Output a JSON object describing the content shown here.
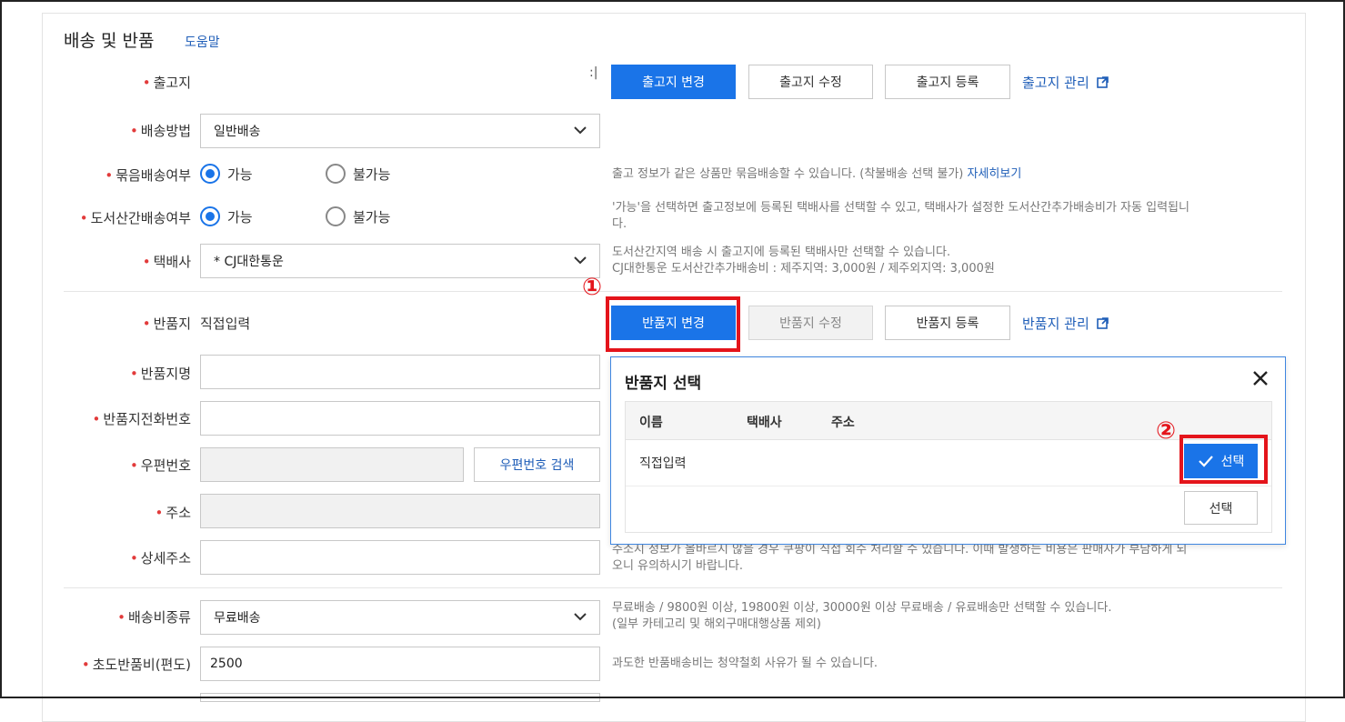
{
  "section": {
    "title": "배송 및 반품",
    "help": "도움말"
  },
  "shipping_from": {
    "label": "출고지",
    "value": ":|",
    "buttons": {
      "change": "출고지 변경",
      "edit": "출고지 수정",
      "register": "출고지 등록"
    },
    "manage_link": "출고지 관리"
  },
  "delivery_method": {
    "label": "배송방법",
    "value": "일반배송"
  },
  "bundle": {
    "label": "묶음배송여부",
    "opt_yes": "가능",
    "opt_no": "불가능",
    "note": "출고 정보가 같은 상품만 묶음배송할 수 있습니다. (착불배송 선택 불가)",
    "note_link": "자세히보기"
  },
  "island": {
    "label": "도서산간배송여부",
    "opt_yes": "가능",
    "opt_no": "불가능",
    "note_line1": "'가능'을 선택하면 출고정보에 등록된 택배사를 선택할 수 있고, 택배사가 설정한 도서산간추가배송비가 자동 입력됩니",
    "note_line2": "다."
  },
  "courier": {
    "label": "택배사",
    "value": "* CJ대한통운",
    "note_line1": "도서산간지역 배송 시 출고지에 등록된 택배사만 선택할 수 있습니다.",
    "note_line2": "CJ대한통운 도서산간추가배송비 : 제주지역: 3,000원 / 제주외지역: 3,000원"
  },
  "return_place": {
    "label": "반품지",
    "value": "직접입력",
    "buttons": {
      "change": "반품지 변경",
      "edit": "반품지 수정",
      "register": "반품지 등록"
    },
    "manage_link": "반품지 관리"
  },
  "return_name": {
    "label": "반품지명"
  },
  "return_phone": {
    "label": "반품지전화번호"
  },
  "zipcode": {
    "label": "우편번호",
    "search_button": "우편번호 검색"
  },
  "address": {
    "label": "주소"
  },
  "address_detail": {
    "label": "상세주소",
    "note_line1": "주소지 정보가 올바르지 않을 경우 쿠팡이 직접 회수 처리할 수 있습니다. 이때 발생하는 비용은 판매자가 부담하게 되",
    "note_line2": "오니 유의하시기 바랍니다."
  },
  "shipping_fee_type": {
    "label": "배송비종류",
    "value": "무료배송",
    "note_line1": "무료배송 / 9800원 이상, 19800원 이상, 30000원 이상 무료배송 / 유료배송만 선택할 수 있습니다.",
    "note_line2": "(일부 카테고리 및 해외구매대행상품 제외)"
  },
  "initial_return_fee": {
    "label": "초도반품비(편도)",
    "value": "2500",
    "note": "과도한 반품배송비는 청약철회 사유가 될 수 있습니다."
  },
  "popup": {
    "title": "반품지 선택",
    "headers": {
      "name": "이름",
      "courier": "택배사",
      "address": "주소"
    },
    "rows": [
      {
        "name": "직접입력",
        "select": "선택"
      },
      {
        "name": "",
        "select": "선택"
      }
    ]
  },
  "markers": {
    "step1": "①",
    "step2": "②"
  },
  "colors": {
    "primary": "#1a74e8",
    "highlight": "#e4141b",
    "link": "#1f5eb8"
  }
}
